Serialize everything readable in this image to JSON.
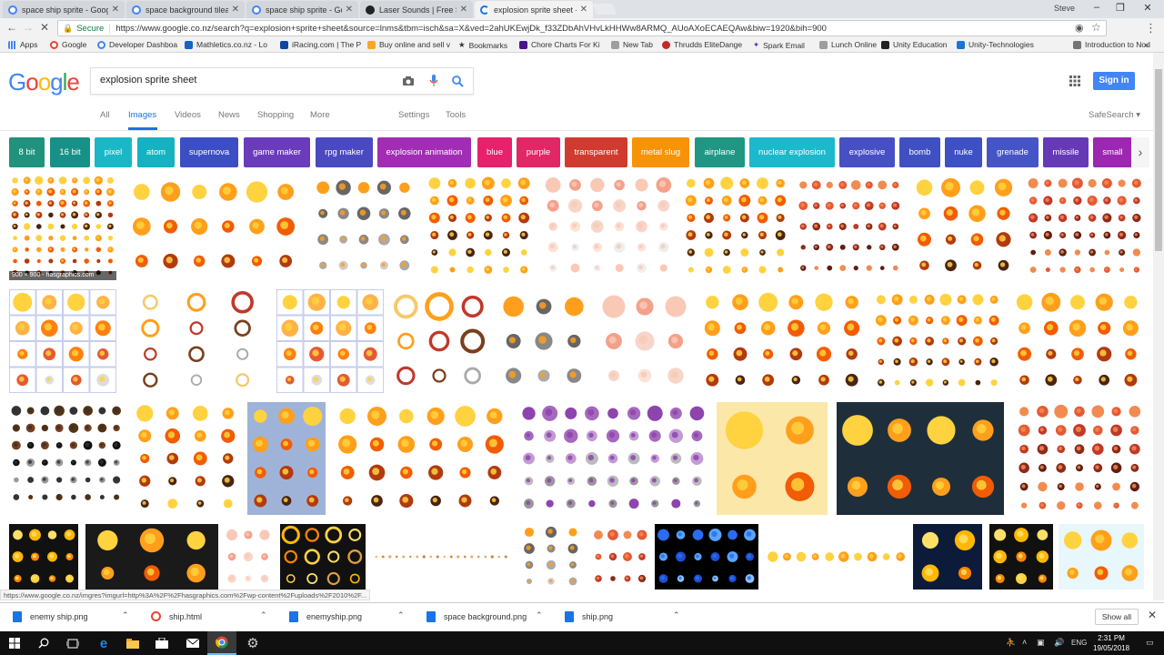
{
  "browser": {
    "tabs": [
      {
        "title": "space ship sprite - Googl",
        "favicon": "google-icon"
      },
      {
        "title": "space background tileab",
        "favicon": "google-icon"
      },
      {
        "title": "space ship sprite - Googl",
        "favicon": "google-icon"
      },
      {
        "title": "Laser Sounds | Free Soun",
        "favicon": "sound-icon"
      },
      {
        "title": "explosion sprite sheet - G",
        "favicon": "loading-icon"
      }
    ],
    "profile_name": "Steve",
    "secure_label": "Secure",
    "url": "https://www.google.co.nz/search?q=explosion+sprite+sheet&source=lnms&tbm=isch&sa=X&ved=2ahUKEwjDk_f33ZDbAhVHvLkHHWw8ARMQ_AUoAXoECAEQAw&biw=1920&bih=900",
    "bookmarks": [
      "Apps",
      "Google",
      "Developer Dashboa",
      "Mathletics.co.nz - Lo",
      "iRacing.com | The P",
      "Buy online and sell v",
      "Bookmarks",
      "Chore Charts For Ki",
      "New Tab",
      "Thrudds EliteDange",
      "Spark Email",
      "Lunch Online",
      "Unity Education",
      "Unity-Technologies",
      "Introduction to Nod"
    ]
  },
  "google": {
    "logo": [
      "G",
      "o",
      "o",
      "g",
      "l",
      "e"
    ],
    "search_query": "explosion sprite sheet",
    "signin_label": "Sign in",
    "nav": [
      "All",
      "Images",
      "Videos",
      "News",
      "Shopping",
      "More",
      "Settings",
      "Tools"
    ],
    "safesearch": "SafeSearch ▾",
    "chips": [
      {
        "label": "8 bit",
        "color": "#20927e"
      },
      {
        "label": "16 bit",
        "color": "#179187"
      },
      {
        "label": "pixel",
        "color": "#1ab8c6"
      },
      {
        "label": "atom",
        "color": "#15b2c1"
      },
      {
        "label": "supernova",
        "color": "#3c4ec4"
      },
      {
        "label": "game maker",
        "color": "#6a3cbb"
      },
      {
        "label": "rpg maker",
        "color": "#4a49c2"
      },
      {
        "label": "explosion animation",
        "color": "#a12db4"
      },
      {
        "label": "blue",
        "color": "#e7216b"
      },
      {
        "label": "purple",
        "color": "#e22766"
      },
      {
        "label": "transparent",
        "color": "#d03b30"
      },
      {
        "label": "metal slug",
        "color": "#f79307"
      },
      {
        "label": "airplane",
        "color": "#209685"
      },
      {
        "label": "nuclear explosion",
        "color": "#1cb9cc"
      },
      {
        "label": "explosive",
        "color": "#4650c4"
      },
      {
        "label": "bomb",
        "color": "#3f51c2"
      },
      {
        "label": "nuke",
        "color": "#3d50c4"
      },
      {
        "label": "grenade",
        "color": "#4655c5"
      },
      {
        "label": "missile",
        "color": "#6639b7"
      },
      {
        "label": "small",
        "color": "#9c27b0"
      }
    ],
    "first_image_caption": "900 × 900 - hasgraphics.com",
    "status_url": "https://www.google.co.nz/imgres?imgurl=http%3A%2F%2Fhasgraphics.com%2Fwp-content%2Fuploads%2F2010%2F..."
  },
  "downloads": {
    "items": [
      "enemy ship.png",
      "ship.html",
      "enemyship.png",
      "space background.png",
      "ship.png"
    ],
    "show_all_label": "Show all"
  },
  "taskbar": {
    "time": "2:31 PM",
    "date": "19/05/2018",
    "language": "ENG"
  }
}
